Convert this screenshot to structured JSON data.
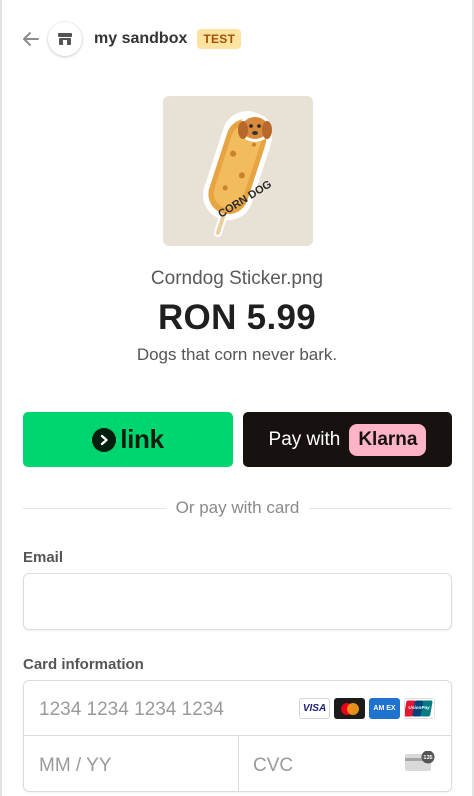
{
  "header": {
    "back_icon": "arrow-left-icon",
    "store_icon": "storefront-icon",
    "merchant_name": "my sandbox",
    "test_badge": "TEST"
  },
  "product": {
    "image_icon": "corndog-sticker-image",
    "sticker_text": "CORN DOG",
    "name": "Corndog Sticker.png",
    "price": "RON 5.99",
    "description": "Dogs that corn never bark."
  },
  "payment_buttons": {
    "link_label": "link",
    "klarna_prefix": "Pay with",
    "klarna_brand": "Klarna",
    "colors": {
      "link": "#00d66f",
      "klarna_bg": "#17120f",
      "klarna_badge": "#ffb3c7"
    }
  },
  "divider_text": "Or pay with card",
  "email": {
    "label": "Email",
    "value": ""
  },
  "card": {
    "label": "Card information",
    "number_placeholder": "1234 1234 1234 1234",
    "expiry_placeholder": "MM / YY",
    "cvc_placeholder": "CVC",
    "brands": [
      "VISA",
      "Mastercard",
      "AMEX",
      "UnionPay"
    ],
    "amex_text": "AM EX",
    "unionpay_text": "UnionPay",
    "cvc_icon_text": "135"
  }
}
